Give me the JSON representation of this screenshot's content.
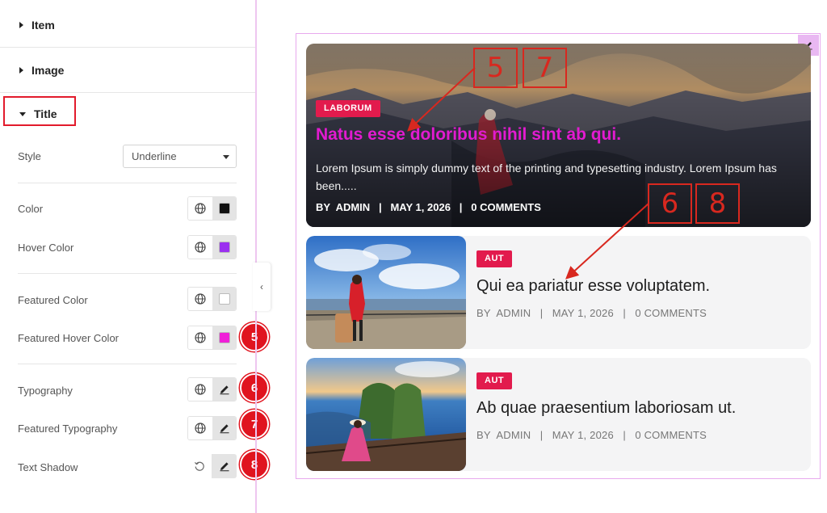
{
  "panel": {
    "sections": {
      "item": "Item",
      "image": "Image",
      "title": "Title"
    },
    "style_label": "Style",
    "style_value": "Underline",
    "controls": {
      "color": {
        "label": "Color",
        "swatch": "#111111"
      },
      "hover_color": {
        "label": "Hover Color",
        "swatch": "#9b30f0"
      },
      "featured_color": {
        "label": "Featured Color",
        "swatch": "#ffffff"
      },
      "featured_hover_color": {
        "label": "Featured Hover Color",
        "swatch": "#f020d8"
      },
      "typography": {
        "label": "Typography"
      },
      "featured_typography": {
        "label": "Featured Typography"
      },
      "text_shadow": {
        "label": "Text Shadow"
      }
    },
    "badges": {
      "b5": "5",
      "b6": "6",
      "b7": "7",
      "b8": "8"
    }
  },
  "preview": {
    "featured": {
      "category": "LABORUM",
      "title": "Natus esse doloribus nihil sint ab qui.",
      "excerpt": "Lorem Ipsum is simply dummy text of the printing and typesetting industry. Lorem Ipsum has been.....",
      "meta": "BY  ADMIN   |   MAY 1, 2026   |   0 COMMENTS"
    },
    "posts": [
      {
        "category": "AUT",
        "title": "Qui ea pariatur esse voluptatem.",
        "meta": "BY  ADMIN   |   MAY 1, 2026   |   0 COMMENTS"
      },
      {
        "category": "AUT",
        "title": "Ab quae praesentium laboriosam ut.",
        "meta": "BY  ADMIN   |   MAY 1, 2026   |   0 COMMENTS"
      }
    ],
    "callouts": {
      "c5": "5",
      "c7": "7",
      "c6": "6",
      "c8": "8"
    }
  },
  "colors": {
    "accent_red": "#e0141f",
    "tag_red": "#e21b4d",
    "featured_title": "#e21bd0",
    "preview_border": "#e8a9ee"
  },
  "icons": [
    "caret-right-icon",
    "caret-down-icon",
    "globe-icon",
    "pencil-icon",
    "reset-icon",
    "chevron-left-icon"
  ]
}
